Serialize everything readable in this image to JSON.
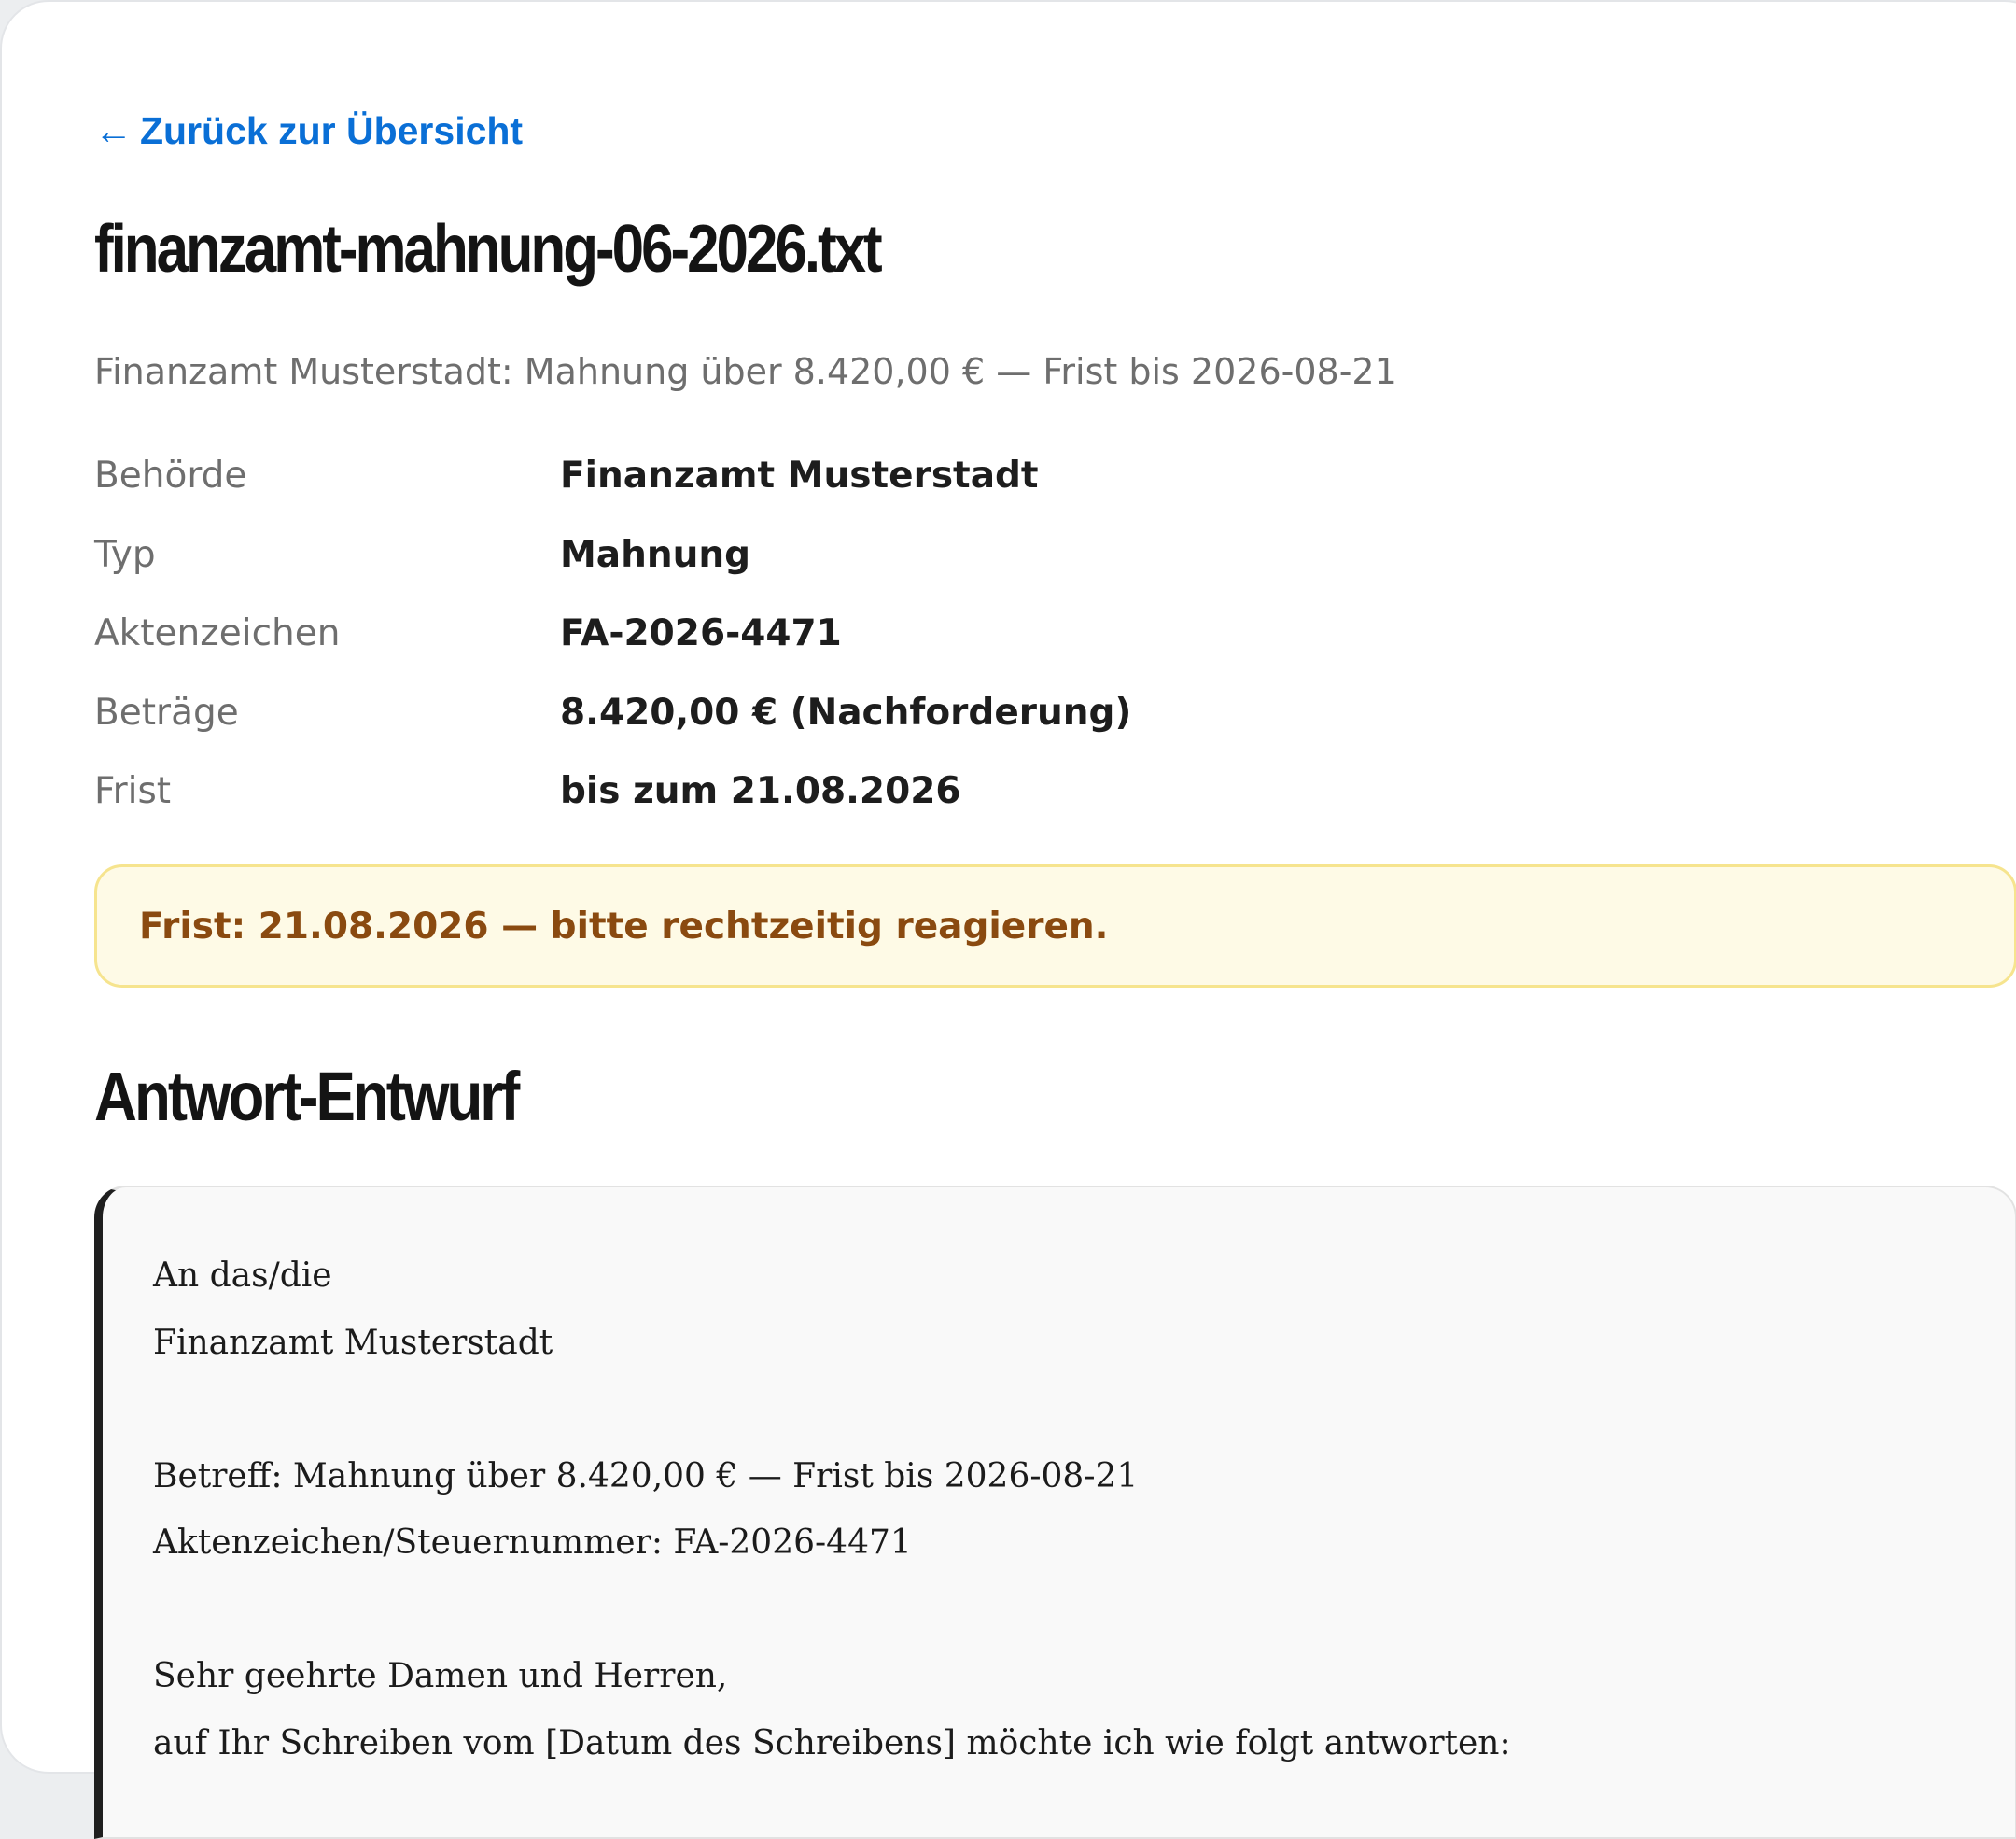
{
  "nav": {
    "back_arrow": "←",
    "back_label": "Zurück zur Übersicht"
  },
  "document": {
    "filename": "finanzamt-mahnung-06-2026.txt",
    "summary": "Finanzamt Musterstadt: Mahnung über 8.420,00 € — Frist bis 2026-08-21"
  },
  "meta": [
    {
      "label": "Behörde",
      "value": "Finanzamt Musterstadt"
    },
    {
      "label": "Typ",
      "value": "Mahnung"
    },
    {
      "label": "Aktenzeichen",
      "value": "FA-2026-4471"
    },
    {
      "label": "Beträge",
      "value": "8.420,00 € (Nachforderung)"
    },
    {
      "label": "Frist",
      "value": "bis zum 21.08.2026"
    }
  ],
  "notice": {
    "text": "Frist: 21.08.2026 — bitte rechtzeitig reagieren."
  },
  "draft": {
    "heading": "Antwort-Entwurf",
    "lines": [
      "An das/die",
      "Finanzamt Musterstadt",
      "",
      "Betreff: Mahnung über 8.420,00 € — Frist bis 2026-08-21",
      "Aktenzeichen/Steuernummer: FA-2026-4471",
      "",
      "Sehr geehrte Damen und Herren,",
      "auf Ihr Schreiben vom [Datum des Schreibens] möchte ich wie folgt antworten:"
    ]
  },
  "colors": {
    "link": "#0a6fd6",
    "notice_background": "#fefae6",
    "notice_border": "#f6e48e",
    "notice_text": "#8a4a10",
    "draft_accent": "#1f1f1f"
  }
}
